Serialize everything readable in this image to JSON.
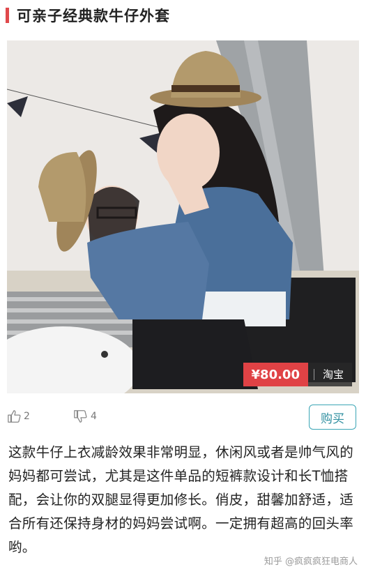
{
  "header": {
    "title": "可亲子经典款牛仔外套"
  },
  "product": {
    "price": "¥80.00",
    "shop": "淘宝"
  },
  "actions": {
    "like_count": "2",
    "dislike_count": "4",
    "buy_label": "购买"
  },
  "description": "这款牛仔上衣减龄效果非常明显，休闲风或者是帅气风的妈妈都可尝试，尤其是这件单品的短裤款设计和长T恤搭配，会让你的双腿显得更加修长。俏皮，甜馨加舒适，适合所有还保持身材的妈妈尝试啊。一定拥有超高的回头率哟。",
  "watermark": "知乎 @疯疯疯狂电商人",
  "colors": {
    "accent": "#e0484b",
    "price_bg": "#e04245",
    "buy_border": "#3aa5b5"
  }
}
